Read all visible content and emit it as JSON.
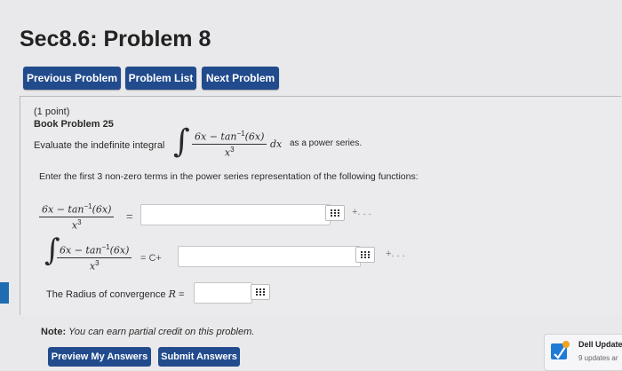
{
  "page": {
    "title": "Sec8.6: Problem 8"
  },
  "nav": {
    "previous_label": "Previous Problem",
    "list_label": "Problem List",
    "next_label": "Next Problem"
  },
  "problem": {
    "points": "(1 point)",
    "book_ref": "Book Problem 25",
    "evaluate_label": "Evaluate the indefinite integral",
    "integrand_numerator": "6x − tan",
    "inv_exp": "−1",
    "integrand_arg": "(6x)",
    "integrand_denominator": "x",
    "den_exp": "3",
    "dx": "dx",
    "as_power_series": "as a power series.",
    "instruction": "Enter the first 3 non-zero terms in the power series representation of the following functions:",
    "equals": "=",
    "plus_dots": "+. . .",
    "equals_c_plus": "= C+",
    "radius_label": "The Radius of convergence",
    "radius_var": "R",
    "radius_equals": "=",
    "note_label": "Note:",
    "note_text": "You can earn partial credit on this problem."
  },
  "answers": {
    "series_value": "",
    "integral_value": "",
    "radius_value": ""
  },
  "actions": {
    "preview_label": "Preview My Answers",
    "submit_label": "Submit Answers"
  },
  "toast": {
    "title": "Dell Update",
    "subtitle": "9 updates ar"
  },
  "colors": {
    "button_blue": "#214b8d",
    "background": "#e9e9eb"
  }
}
